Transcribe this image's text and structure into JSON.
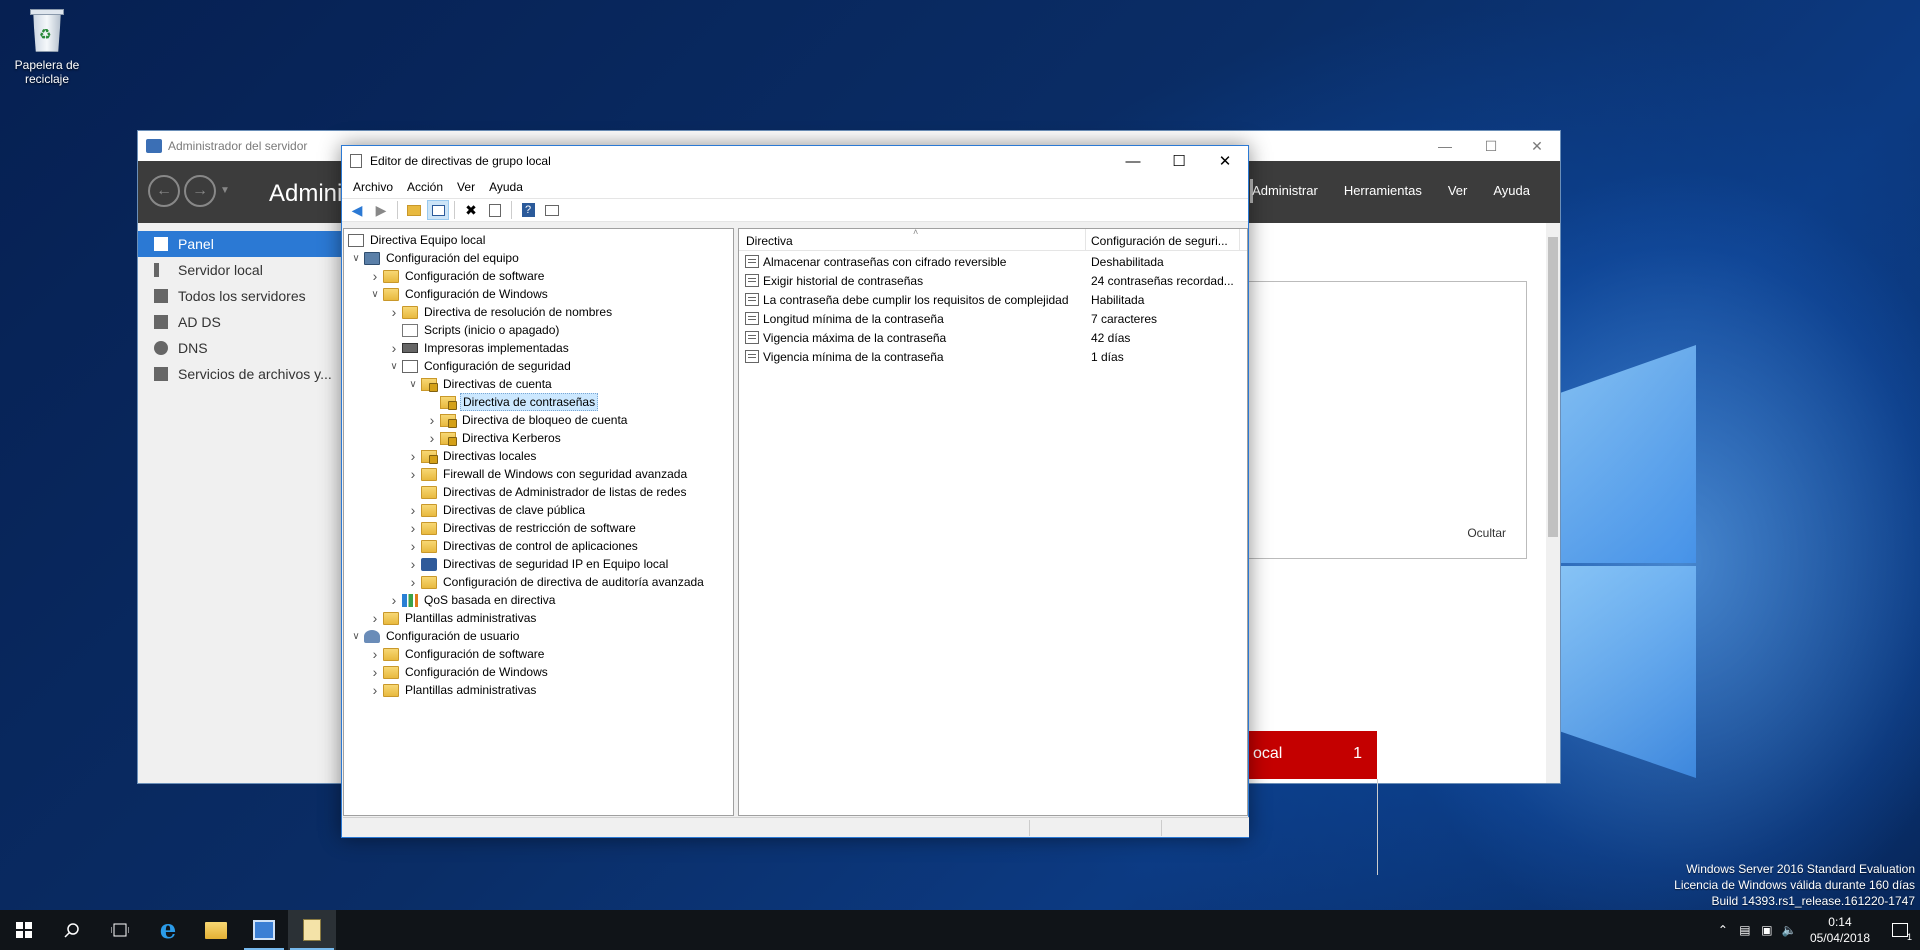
{
  "desktop": {
    "recycle_bin_label": "Papelera de reciclaje",
    "watermark": {
      "line1": "Windows Server 2016 Standard Evaluation",
      "line2": "Licencia de Windows válida durante 160 días",
      "line3": "Build 14393.rs1_release.161220-1747"
    }
  },
  "taskbar": {
    "clock_time": "0:14",
    "clock_date": "05/04/2018",
    "notification_count": "1",
    "colors": {
      "background": "#101418",
      "active_indicator": "#76b9ed"
    }
  },
  "server_manager": {
    "title": "Administrador del servidor",
    "header_title": "Admini",
    "menu": [
      "Administrar",
      "Herramientas",
      "Ver",
      "Ayuda"
    ],
    "sidebar": [
      {
        "label": "Panel",
        "icon": "dashboard-icon",
        "selected": true
      },
      {
        "label": "Servidor local",
        "icon": "server-icon",
        "selected": false
      },
      {
        "label": "Todos los servidores",
        "icon": "servers-icon",
        "selected": false
      },
      {
        "label": "AD DS",
        "icon": "adds-icon",
        "selected": false
      },
      {
        "label": "DNS",
        "icon": "dns-icon",
        "selected": false
      },
      {
        "label": "Servicios de archivos y...",
        "icon": "file-services-icon",
        "selected": false
      }
    ],
    "hide_label": "Ocultar",
    "tile_label": "ocal",
    "tile_count": "1",
    "colors": {
      "header": "#3c3c3c",
      "selected": "#2b79d4",
      "tile": "#c40000"
    }
  },
  "gpe": {
    "title": "Editor de directivas de grupo local",
    "menu": [
      "Archivo",
      "Acción",
      "Ver",
      "Ayuda"
    ],
    "toolbar": [
      "back-icon",
      "forward-icon",
      "up-folder-icon",
      "show-hide-tree-icon",
      "delete-icon",
      "export-icon",
      "help-icon",
      "properties-icon"
    ],
    "tree": [
      {
        "label": "Directiva Equipo local",
        "level": 0,
        "expander": "",
        "icon": "policy"
      },
      {
        "label": "Configuración del equipo",
        "level": 0,
        "expander": "open",
        "icon": "computer"
      },
      {
        "label": "Configuración de software",
        "level": 1,
        "expander": "closed",
        "icon": "folder"
      },
      {
        "label": "Configuración de Windows",
        "level": 1,
        "expander": "open",
        "icon": "folder"
      },
      {
        "label": "Directiva de resolución de nombres",
        "level": 2,
        "expander": "closed",
        "icon": "folder"
      },
      {
        "label": "Scripts (inicio o apagado)",
        "level": 2,
        "expander": "",
        "icon": "doc"
      },
      {
        "label": "Impresoras implementadas",
        "level": 2,
        "expander": "closed",
        "icon": "printer"
      },
      {
        "label": "Configuración de seguridad",
        "level": 2,
        "expander": "open",
        "icon": "policy"
      },
      {
        "label": "Directivas de cuenta",
        "level": 3,
        "expander": "open",
        "icon": "lockfolder"
      },
      {
        "label": "Directiva de contraseñas",
        "level": 4,
        "expander": "",
        "icon": "lockfolder",
        "selected": true
      },
      {
        "label": "Directiva de bloqueo de cuenta",
        "level": 4,
        "expander": "closed",
        "icon": "lockfolder"
      },
      {
        "label": "Directiva Kerberos",
        "level": 4,
        "expander": "closed",
        "icon": "lockfolder"
      },
      {
        "label": "Directivas locales",
        "level": 3,
        "expander": "closed",
        "icon": "lockfolder"
      },
      {
        "label": "Firewall de Windows con seguridad avanzada",
        "level": 3,
        "expander": "closed",
        "icon": "folder"
      },
      {
        "label": "Directivas de Administrador de listas de redes",
        "level": 3,
        "expander": "",
        "icon": "folder"
      },
      {
        "label": "Directivas de clave pública",
        "level": 3,
        "expander": "closed",
        "icon": "folder"
      },
      {
        "label": "Directivas de restricción de software",
        "level": 3,
        "expander": "closed",
        "icon": "folder"
      },
      {
        "label": "Directivas de control de aplicaciones",
        "level": 3,
        "expander": "closed",
        "icon": "folder"
      },
      {
        "label": "Directivas de seguridad IP en Equipo local",
        "level": 3,
        "expander": "closed",
        "icon": "shield"
      },
      {
        "label": "Configuración de directiva de auditoría avanzada",
        "level": 3,
        "expander": "closed",
        "icon": "folder"
      },
      {
        "label": "QoS basada en directiva",
        "level": 2,
        "expander": "closed",
        "icon": "chart"
      },
      {
        "label": "Plantillas administrativas",
        "level": 1,
        "expander": "closed",
        "icon": "folder"
      },
      {
        "label": "Configuración de usuario",
        "level": 0,
        "expander": "open",
        "icon": "user"
      },
      {
        "label": "Configuración de software",
        "level": 1,
        "expander": "closed",
        "icon": "folder"
      },
      {
        "label": "Configuración de Windows",
        "level": 1,
        "expander": "closed",
        "icon": "folder"
      },
      {
        "label": "Plantillas administrativas",
        "level": 1,
        "expander": "closed",
        "icon": "folder"
      }
    ],
    "list": {
      "columns": [
        "Directiva",
        "Configuración de seguri..."
      ],
      "rows": [
        {
          "name": "Almacenar contraseñas con cifrado reversible",
          "value": "Deshabilitada"
        },
        {
          "name": "Exigir historial de contraseñas",
          "value": "24 contraseñas recordad..."
        },
        {
          "name": "La contraseña debe cumplir los requisitos de complejidad",
          "value": "Habilitada"
        },
        {
          "name": "Longitud mínima de la contraseña",
          "value": "7 caracteres"
        },
        {
          "name": "Vigencia máxima de la contraseña",
          "value": "42 días"
        },
        {
          "name": "Vigencia mínima de la contraseña",
          "value": "1 días"
        }
      ]
    }
  }
}
